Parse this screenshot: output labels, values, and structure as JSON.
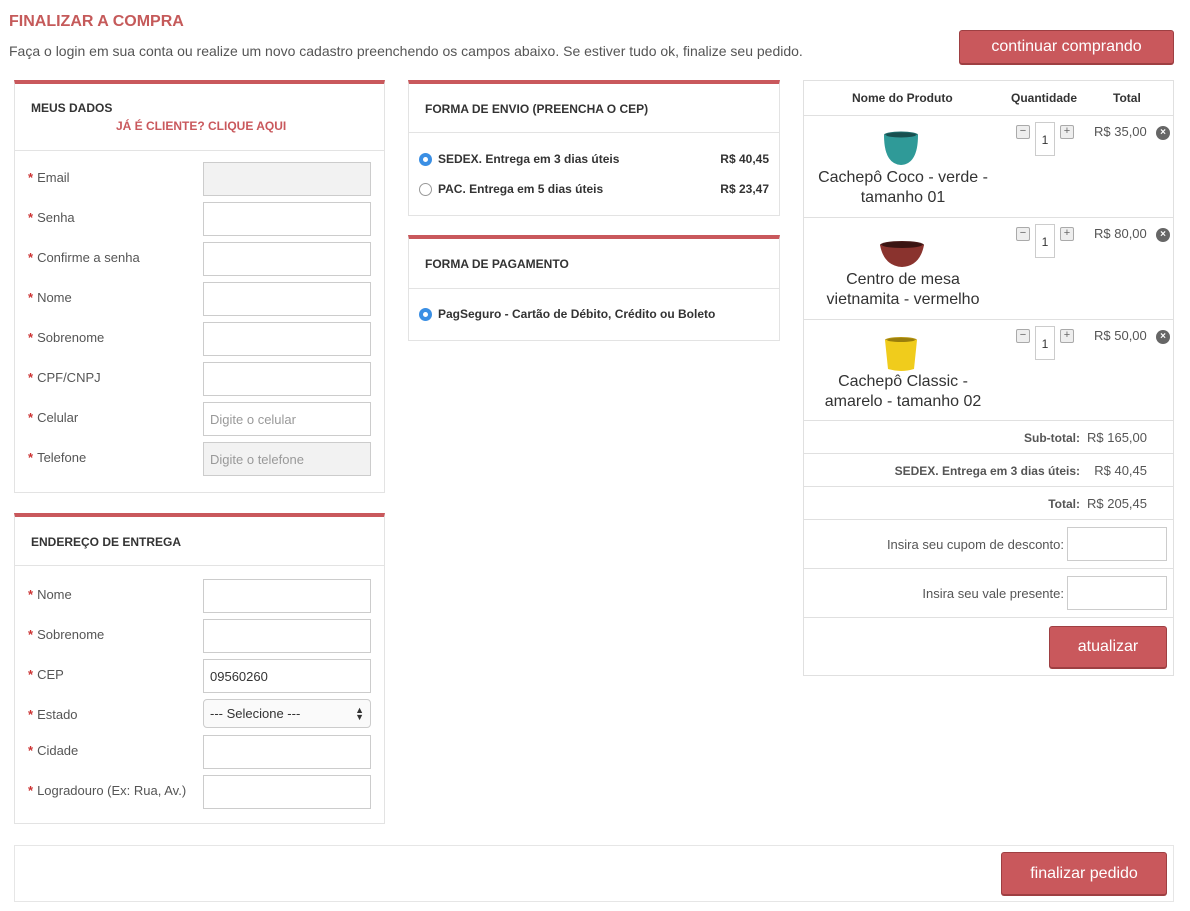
{
  "header": {
    "title": "FINALIZAR A COMPRA",
    "subtitle": "Faça o login em sua conta ou realize um novo cadastro preenchendo os campos abaixo. Se estiver tudo ok, finalize seu pedido.",
    "continue_label": "continuar comprando"
  },
  "meus_dados": {
    "title": "MEUS DADOS",
    "login_link": "JÁ É CLIENTE? CLIQUE AQUI",
    "fields": [
      {
        "label": "Email",
        "placeholder": "",
        "value": ""
      },
      {
        "label": "Senha",
        "placeholder": "",
        "value": ""
      },
      {
        "label": "Confirme a senha",
        "placeholder": "",
        "value": ""
      },
      {
        "label": "Nome",
        "placeholder": "",
        "value": ""
      },
      {
        "label": "Sobrenome",
        "placeholder": "",
        "value": ""
      },
      {
        "label": "CPF/CNPJ",
        "placeholder": "",
        "value": ""
      },
      {
        "label": "Celular",
        "placeholder": "Digite o celular",
        "value": ""
      },
      {
        "label": "Telefone",
        "placeholder": "Digite o telefone",
        "value": ""
      }
    ]
  },
  "endereco": {
    "title": "ENDEREÇO DE ENTREGA",
    "fields": [
      {
        "label": "Nome",
        "value": ""
      },
      {
        "label": "Sobrenome",
        "value": ""
      },
      {
        "label": "CEP",
        "value": "09560260"
      },
      {
        "label": "Estado",
        "value": "--- Selecione ---"
      },
      {
        "label": "Cidade",
        "value": ""
      },
      {
        "label": "Logradouro (Ex: Rua, Av.)",
        "value": ""
      }
    ]
  },
  "envio": {
    "title": "FORMA DE ENVIO (PREENCHA O CEP)",
    "options": [
      {
        "label": "SEDEX. Entrega em 3 dias úteis",
        "price": "R$ 40,45",
        "selected": true
      },
      {
        "label": "PAC. Entrega em 5 dias úteis",
        "price": "R$ 23,47",
        "selected": false
      }
    ]
  },
  "pagamento": {
    "title": "FORMA DE PAGAMENTO",
    "options": [
      {
        "label": "PagSeguro - Cartão de Débito, Crédito ou Boleto",
        "selected": true
      }
    ]
  },
  "cart": {
    "headers": {
      "product": "Nome do Produto",
      "qty": "Quantidade",
      "total": "Total"
    },
    "items": [
      {
        "name": "Cachepô Coco - verde - tamanho 01",
        "qty": "1",
        "price": "R$ 35,00",
        "color": "#2f8f8f",
        "icon": "teal-pot-icon"
      },
      {
        "name": "Centro de mesa vietnamita - vermelho",
        "qty": "1",
        "price": "R$ 80,00",
        "color": "#7a2f2a",
        "icon": "red-bowl-icon"
      },
      {
        "name": "Cachepô Classic - amarelo - tamanho 02",
        "qty": "1",
        "price": "R$ 50,00",
        "color": "#e8c41a",
        "icon": "yellow-pot-icon"
      }
    ],
    "subtotal_label": "Sub-total:",
    "subtotal_value": "R$ 165,00",
    "shipping_label": "SEDEX. Entrega em 3 dias úteis:",
    "shipping_value": "R$ 40,45",
    "total_label": "Total:",
    "total_value": "R$ 205,45",
    "coupon_label": "Insira seu cupom de desconto:",
    "voucher_label": "Insira seu vale presente:",
    "update_label": "atualizar"
  },
  "footer": {
    "finalize_label": "finalizar pedido"
  },
  "colors": {
    "accent": "#c9585c",
    "title": "#c55a5a",
    "radio": "#3b8fe4"
  }
}
